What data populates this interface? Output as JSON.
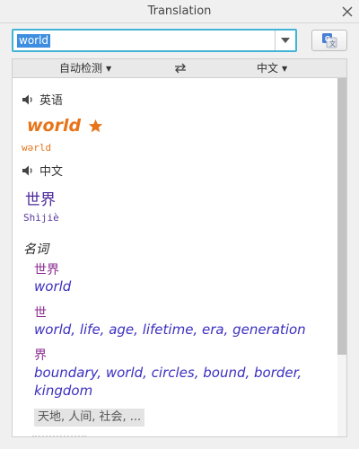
{
  "window": {
    "title": "Translation"
  },
  "search": {
    "value": "world"
  },
  "lang": {
    "from": "自动检测",
    "to": "中文"
  },
  "result": {
    "source_lang_label": "英语",
    "headword": "world",
    "headword_phonetic": "wərld",
    "target_lang_label": "中文",
    "translation": "世界",
    "pinyin": "Shìjiè",
    "part_of_speech": "名词",
    "senses": [
      {
        "zh": "世界",
        "en": "world"
      },
      {
        "zh": "世",
        "en": "world, life, age, lifetime, era, generation"
      },
      {
        "zh": "界",
        "en_line1": "boundary, world, circles, bound, border,",
        "en_line2": "kingdom"
      }
    ],
    "more_chip": "天地, 人间, 社会, ..."
  },
  "colors": {
    "accent_orange": "#e8741a",
    "sense_blue": "#3b2fbf",
    "zh_purple": "#8a2a8f",
    "focus_border": "#44b4d6"
  },
  "icons": {
    "close": "close-icon",
    "dropdown": "chevron-down-icon",
    "translate": "google-translate-icon",
    "swap": "swap-arrows-icon",
    "speaker": "speaker-icon",
    "favorite": "star-icon"
  }
}
